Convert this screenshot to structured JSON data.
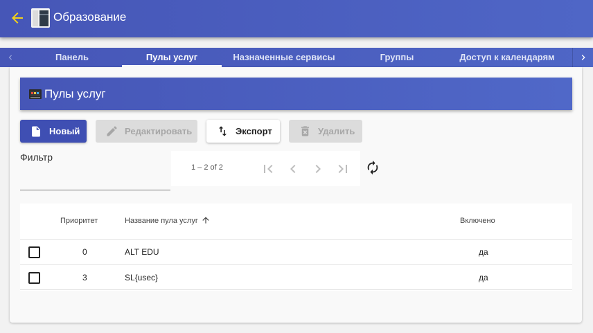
{
  "header": {
    "title": "Образование",
    "back_icon": "arrow-left-icon",
    "accent_color": "#f2d11b"
  },
  "tabs": [
    {
      "label": "Панель",
      "active": false
    },
    {
      "label": "Пулы услуг",
      "active": true
    },
    {
      "label": "Назначенные сервисы",
      "active": false
    },
    {
      "label": "Группы",
      "active": false
    },
    {
      "label": "Доступ к календарям",
      "active": false
    }
  ],
  "section": {
    "title": "Пулы услуг"
  },
  "toolbar": {
    "new_label": "Новый",
    "edit_label": "Редактировать",
    "export_label": "Экспорт",
    "delete_label": "Удалить"
  },
  "filter": {
    "label": "Фильтр",
    "value": "",
    "placeholder": ""
  },
  "pager": {
    "range": "1 – 2 of 2"
  },
  "table": {
    "columns": {
      "priority": "Приоритет",
      "name": "Название пула услуг",
      "enabled": "Включено"
    },
    "rows": [
      {
        "priority": "0",
        "name": "ALT EDU",
        "enabled": "да"
      },
      {
        "priority": "3",
        "name": "SL{usec}",
        "enabled": "да"
      }
    ]
  },
  "colors": {
    "primary": "#4656b7",
    "button_primary": "#3f4fb3",
    "disabled": "#dcdcdc"
  }
}
